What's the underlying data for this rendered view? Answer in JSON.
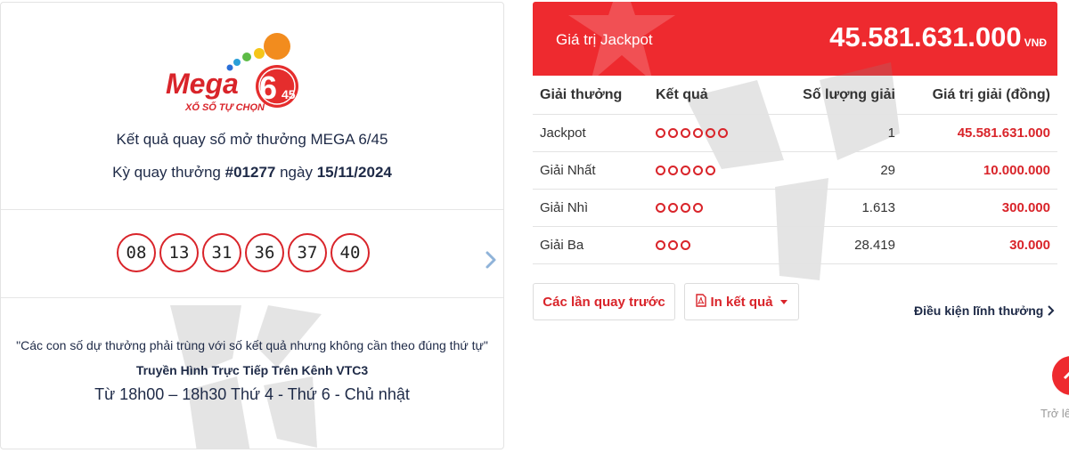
{
  "logo": {
    "brand": "Mega",
    "number": "6",
    "suffix": "45",
    "tagline": "XỔ SỐ TỰ CHỌN"
  },
  "result": {
    "title": "Kết quả quay số mở thưởng MEGA 6/45",
    "draw_prefix": "Kỳ quay thưởng",
    "draw_number": "#01277",
    "date_prefix": "ngày",
    "date": "15/11/2024"
  },
  "numbers": [
    "08",
    "13",
    "31",
    "36",
    "37",
    "40"
  ],
  "notes": {
    "quote": "\"Các con số dự thưởng phải trùng với số kết quả nhưng không cần theo đúng thứ tự\"",
    "channel": "Truyền Hình Trực Tiếp Trên Kênh VTC3",
    "time": "Từ 18h00 – 18h30 Thứ 4 - Thứ 6 - Chủ nhật"
  },
  "jackpot": {
    "label": "Giá trị Jackpot",
    "value": "45.581.631.000",
    "unit": "VNĐ"
  },
  "table": {
    "headers": {
      "prize": "Giải thưởng",
      "result": "Kết quả",
      "count": "Số lượng giải",
      "value": "Giá trị giải (đồng)"
    },
    "rows": [
      {
        "prize": "Jackpot",
        "matches": 6,
        "count": "1",
        "value": "45.581.631.000"
      },
      {
        "prize": "Giải Nhất",
        "matches": 5,
        "count": "29",
        "value": "10.000.000"
      },
      {
        "prize": "Giải Nhì",
        "matches": 4,
        "count": "1.613",
        "value": "300.000"
      },
      {
        "prize": "Giải Ba",
        "matches": 3,
        "count": "28.419",
        "value": "30.000"
      }
    ]
  },
  "actions": {
    "previous_draws": "Các lần quay trước",
    "print": "In kết quả",
    "conditions": "Điều kiện lĩnh thưởng",
    "back_to_top": "Trở lê"
  },
  "colors": {
    "accent_red": "#ee2a2f",
    "text_navy": "#1e2a47",
    "ball_border": "#d9242a"
  },
  "icons": {
    "next": "chevron-right-icon",
    "pdf": "pdf-file-icon",
    "dropdown": "caret-down-icon",
    "conditions": "chevron-right-icon",
    "back_to_top": "arrow-up-icon"
  }
}
